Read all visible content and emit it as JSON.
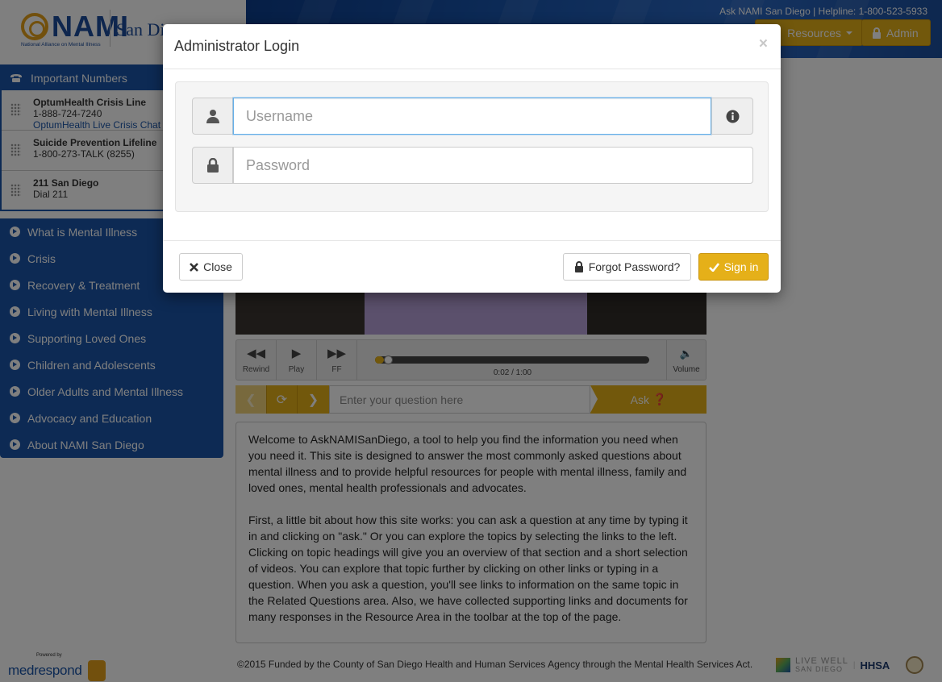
{
  "header": {
    "logo_text": "NAMI",
    "logo_subtitle": "National Alliance on Mental Illness",
    "logo_city": "San Diego",
    "helpline": "Ask NAMI San Diego | Helpline: 1-800-523-5933",
    "nav": {
      "resources_label": "Resources",
      "admin_label": "Admin"
    }
  },
  "sidebar": {
    "numbers_title": "Important Numbers",
    "numbers": [
      {
        "name": "OptumHealth Crisis Line",
        "phone": "1-888-724-7240",
        "link": "OptumHealth Live Crisis Chat"
      },
      {
        "name": "Suicide Prevention Lifeline",
        "phone": "1-800-273-TALK (8255)"
      },
      {
        "name": "211 San Diego",
        "phone": "Dial 211"
      }
    ],
    "menu": [
      "What is Mental Illness",
      "Crisis",
      "Recovery & Treatment",
      "Living with Mental Illness",
      "Supporting Loved Ones",
      "Children and Adolescents",
      "Older Adults and Mental Illness",
      "Advocacy and Education",
      "About NAMI San Diego"
    ]
  },
  "player": {
    "rewind_label": "Rewind",
    "play_label": "Play",
    "ff_label": "FF",
    "volume_label": "Volume",
    "time": "0:02 / 1:00",
    "progress": 0.033
  },
  "ask": {
    "placeholder": "Enter your question here",
    "button_label": "Ask"
  },
  "welcome": {
    "paragraph1": "Welcome to AskNAMISanDiego, a tool to help you find the information you need when you need it. This site is designed to answer the most commonly asked questions about mental illness and to provide helpful resources for people with mental illness, family and loved ones, mental health professionals and advocates.",
    "paragraph2": "First, a little bit about how this site works: you can ask a question at any time by typing it in and clicking on \"ask.\" Or you can explore the topics by selecting the links to the left. Clicking on topic headings will give you an overview of that section and a short selection of videos. You can explore that topic further by clicking on other links or typing in a question. When you ask a question, you'll see links to information on the same topic in the Related Questions area. Also, we have collected supporting links and documents for many responses in the Resource Area in the toolbar at the top of the page."
  },
  "footer": {
    "powered_by": "Powered by",
    "brand": "medrespond",
    "copyright": "©2015 Funded by the County of San Diego Health and Human Services Agency through the Mental Health Services Act.",
    "partner_livewell": "LIVE WELL",
    "partner_livewell_sub": "SAN DIEGO",
    "partner_hhsa": "HHSA"
  },
  "modal": {
    "title": "Administrator Login",
    "close_symbol": "×",
    "username_placeholder": "Username",
    "password_placeholder": "Password",
    "close_label": "Close",
    "forgot_label": "Forgot Password?",
    "signin_label": "Sign in"
  },
  "colors": {
    "brand_blue": "#1a55a8",
    "accent_gold": "#e5b019",
    "focus_blue": "#66afe9"
  },
  "icons": {
    "phone": "phone-icon",
    "user": "user-icon",
    "lock": "lock-icon",
    "info": "info-circle-icon",
    "close": "times-icon",
    "check": "check-icon"
  }
}
